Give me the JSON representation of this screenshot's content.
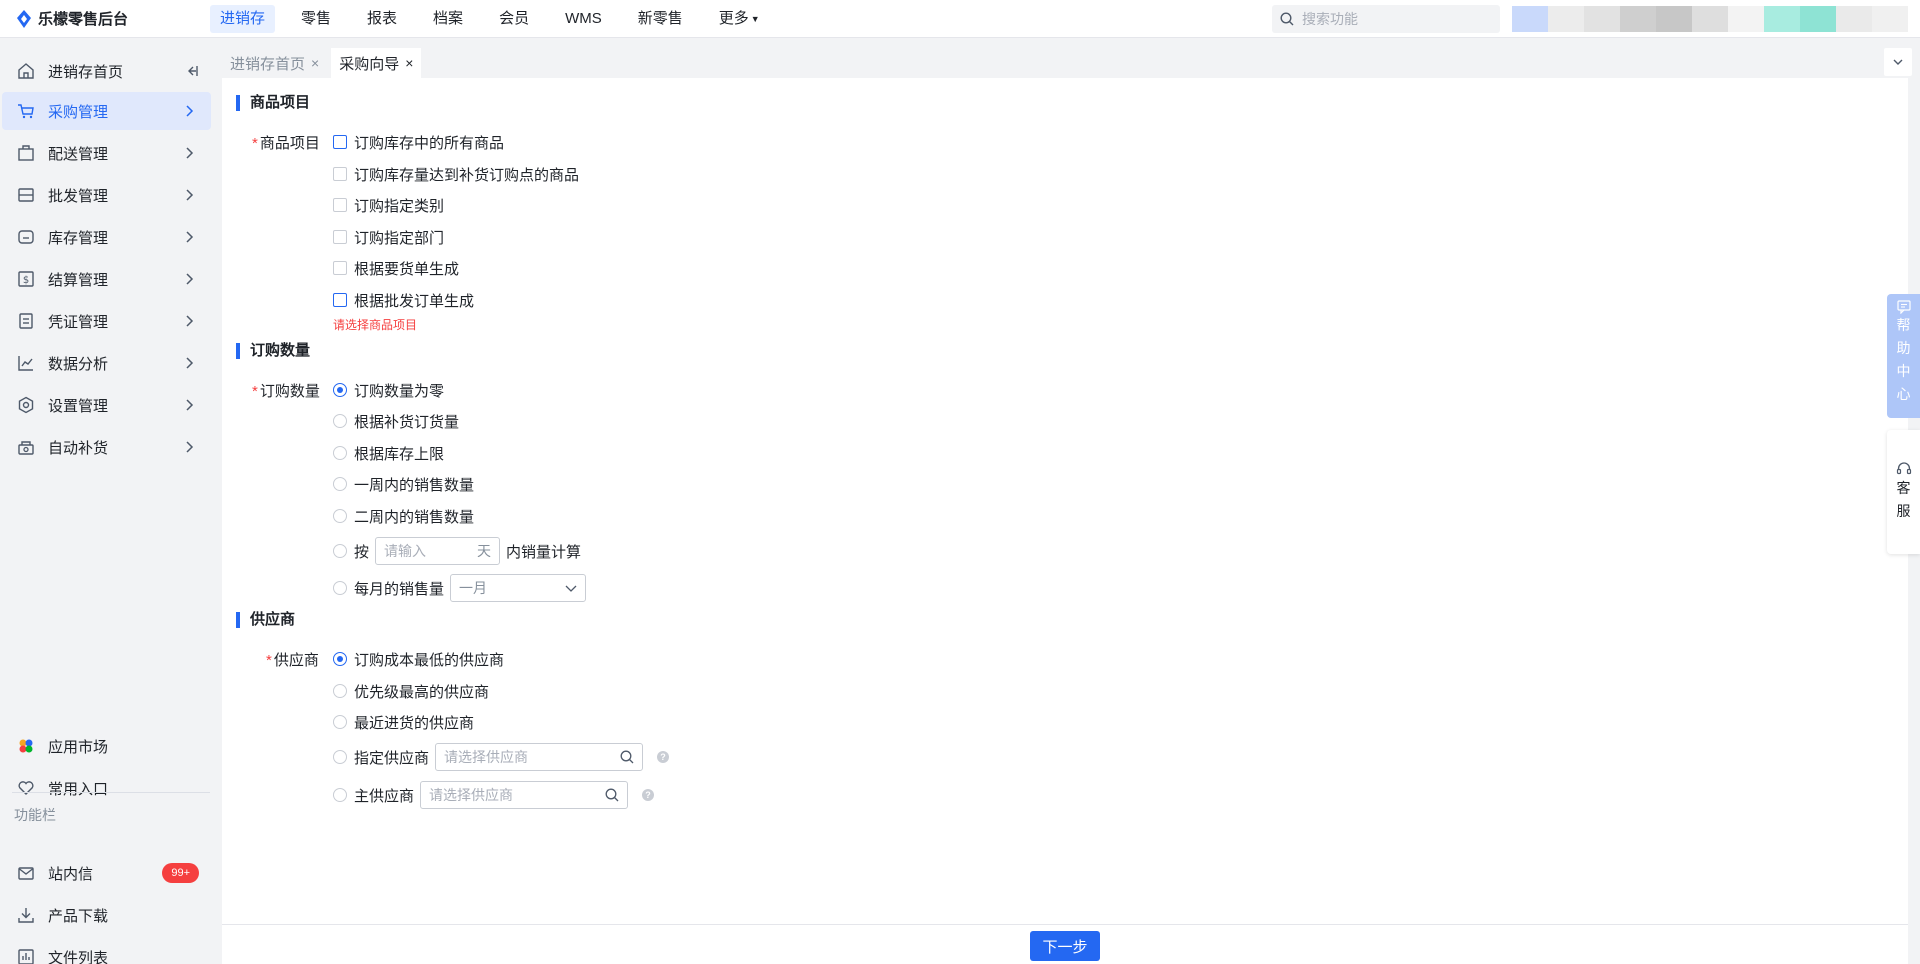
{
  "app": {
    "brand": "乐檬零售后台"
  },
  "topnav": [
    {
      "label": "进销存",
      "active": true
    },
    {
      "label": "零售"
    },
    {
      "label": "报表"
    },
    {
      "label": "档案"
    },
    {
      "label": "会员"
    },
    {
      "label": "WMS"
    },
    {
      "label": "新零售"
    },
    {
      "label": "更多"
    }
  ],
  "search": {
    "placeholder": "搜索功能"
  },
  "sidebar": {
    "items": [
      {
        "label": "进销存首页",
        "icon": "home-icon"
      },
      {
        "label": "采购管理",
        "icon": "cart-icon",
        "active": true
      },
      {
        "label": "配送管理",
        "icon": "delivery-icon"
      },
      {
        "label": "批发管理",
        "icon": "wholesale-icon"
      },
      {
        "label": "库存管理",
        "icon": "inventory-icon"
      },
      {
        "label": "结算管理",
        "icon": "settlement-icon"
      },
      {
        "label": "凭证管理",
        "icon": "voucher-icon"
      },
      {
        "label": "数据分析",
        "icon": "chart-icon"
      },
      {
        "label": "设置管理",
        "icon": "settings-icon"
      },
      {
        "label": "自动补货",
        "icon": "auto-replenish-icon"
      }
    ],
    "bottom": [
      {
        "label": "应用市场",
        "icon": "app-market-icon"
      },
      {
        "label": "常用入口",
        "icon": "heart-icon"
      }
    ],
    "section_label": "功能栏",
    "functions": [
      {
        "label": "站内信",
        "icon": "mail-icon",
        "badge": "99+"
      },
      {
        "label": "产品下载",
        "icon": "download-icon"
      },
      {
        "label": "文件列表",
        "icon": "file-list-icon"
      }
    ]
  },
  "tabs": [
    {
      "label": "进销存首页",
      "close": "×"
    },
    {
      "label": "采购向导",
      "close": "×",
      "active": true
    }
  ],
  "form": {
    "section1": {
      "title": "商品项目",
      "label": "商品项目",
      "options": [
        "订购库存中的所有商品",
        "订购库存量达到补货订购点的商品",
        "订购指定类别",
        "订购指定部门",
        "根据要货单生成",
        "根据批发订单生成"
      ],
      "error": "请选择商品项目"
    },
    "section2": {
      "title": "订购数量",
      "label": "订购数量",
      "options": [
        "订购数量为零",
        "根据补货订货量",
        "根据库存上限",
        "一周内的销售数量",
        "二周内的销售数量"
      ],
      "selected_index": 0,
      "days_option": {
        "prefix": "按",
        "placeholder": "请输入",
        "suffix": "天",
        "after": "内销量计算"
      },
      "monthly_option": {
        "label": "每月的销售量",
        "select_value": "一月"
      }
    },
    "section3": {
      "title": "供应商",
      "label": "供应商",
      "options": [
        "订购成本最低的供应商",
        "优先级最高的供应商",
        "最近进货的供应商"
      ],
      "selected_index": 0,
      "specified": {
        "label": "指定供应商",
        "placeholder": "请选择供应商"
      },
      "main": {
        "label": "主供应商",
        "placeholder": "请选择供应商"
      }
    }
  },
  "footer": {
    "next_label": "下一步"
  },
  "float": {
    "help": [
      "帮",
      "助",
      "中",
      "心"
    ],
    "service": [
      "客",
      "服"
    ]
  },
  "colors": {
    "accent": "#2468f2",
    "error": "#f53f3f"
  }
}
